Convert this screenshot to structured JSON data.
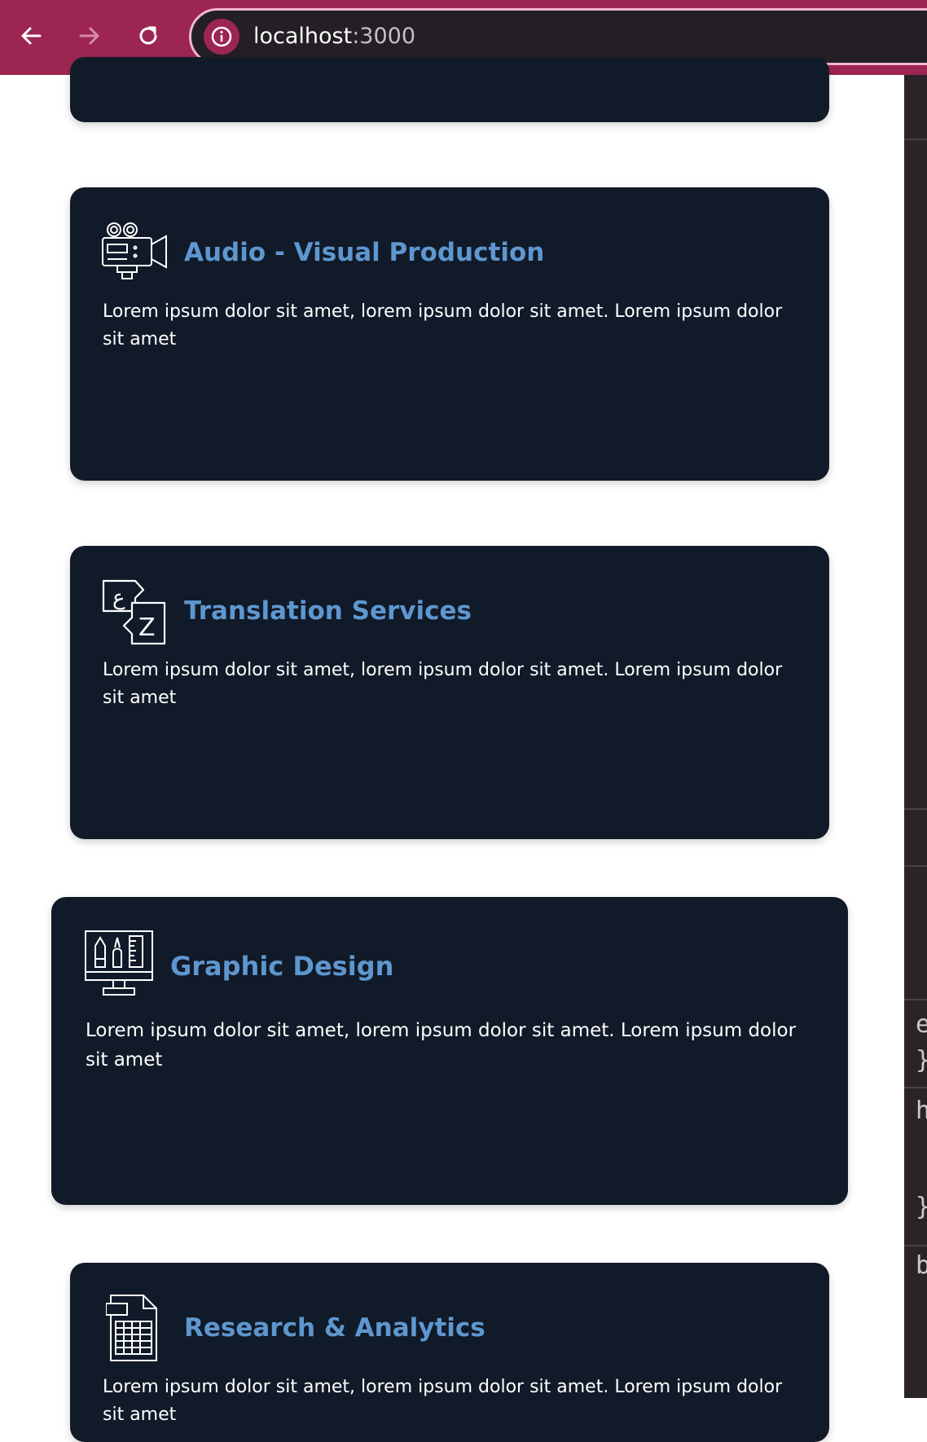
{
  "browser": {
    "back_icon": "arrow-left-icon",
    "forward_icon": "arrow-right-icon",
    "reload_icon": "reload-icon",
    "site_info_icon": "info-icon",
    "url_host": "localhost",
    "url_port": ":3000"
  },
  "services": [
    {
      "icon": "video-camera-icon",
      "title": "Audio - Visual Production",
      "description": "Lorem ipsum dolor sit amet, lorem ipsum dolor sit amet. Lorem ipsum dolor sit amet"
    },
    {
      "icon": "translation-icon",
      "title": "Translation Services",
      "description": "Lorem ipsum dolor sit amet, lorem ipsum dolor sit amet. Lorem ipsum dolor sit amet"
    },
    {
      "icon": "design-monitor-icon",
      "title": "Graphic Design",
      "description": "Lorem ipsum dolor sit amet, lorem ipsum dolor sit amet. Lorem ipsum dolor sit amet"
    },
    {
      "icon": "spreadsheet-icon",
      "title": "Research & Analytics",
      "description": "Lorem ipsum dolor sit amet, lorem ipsum dolor sit amet. Lorem ipsum dolor sit amet"
    }
  ],
  "devtools": {
    "chars": [
      "e",
      "}",
      "h",
      "}",
      "b"
    ]
  },
  "colors": {
    "chrome": "#9c2651",
    "card_bg": "#111a28",
    "title": "#5e97cf",
    "text": "#ffffff"
  }
}
